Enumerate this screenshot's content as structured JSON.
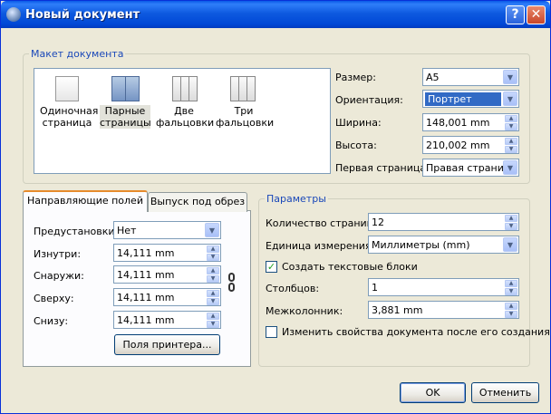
{
  "window": {
    "title": "Новый документ",
    "help": "?",
    "close": "✕"
  },
  "layout_group": {
    "title": "Макет документа",
    "layouts": [
      {
        "line1": "Одиночная",
        "line2": "страница"
      },
      {
        "line1": "Парные",
        "line2": "страницы"
      },
      {
        "line1": "Две",
        "line2": "фальцовки"
      },
      {
        "line1": "Три",
        "line2": "фальцовки"
      }
    ],
    "selected": "Парные страницы"
  },
  "size": {
    "label": "Размер:",
    "value": "A5"
  },
  "orientation": {
    "label": "Ориентация:",
    "value": "Портрет"
  },
  "width": {
    "label": "Ширина:",
    "value": "148,001 mm"
  },
  "height": {
    "label": "Высота:",
    "value": "210,002 mm"
  },
  "first_page": {
    "label": "Первая страница:",
    "value": "Правая страница"
  },
  "tabs": {
    "margins": "Направляющие полей",
    "bleed": "Выпуск под обрез",
    "active": "Направляющие полей"
  },
  "margins": {
    "presets": {
      "label": "Предустановки:",
      "value": "Нет"
    },
    "inside": {
      "label": "Изнутри:",
      "value": "14,111 mm"
    },
    "outside": {
      "label": "Снаружи:",
      "value": "14,111 mm"
    },
    "top": {
      "label": "Сверху:",
      "value": "14,111 mm"
    },
    "bottom": {
      "label": "Снизу:",
      "value": "14,111 mm"
    },
    "printer_button": "Поля принтера..."
  },
  "options": {
    "title": "Параметры",
    "page_count": {
      "label": "Количество страниц:",
      "value": "12"
    },
    "units": {
      "label": "Единица измерения:",
      "value": "Миллиметры (mm)"
    },
    "create_text_frames": {
      "label": "Создать текстовые блоки",
      "checked": true
    },
    "columns": {
      "label": "Столбцов:",
      "value": "1"
    },
    "gap": {
      "label": "Межколонник:",
      "value": "3,881 mm"
    },
    "change_settings": {
      "label": "Изменить свойства документа после его создания",
      "checked": false
    }
  },
  "buttons": {
    "ok": "OK",
    "cancel": "Отменить"
  },
  "icons": {
    "arrow": "▼",
    "up": "▲",
    "down": "▼",
    "check": "✓"
  },
  "colors": {
    "title_bar": "#0148d6",
    "selection": "#316ac5",
    "group_title": "#1a48b9"
  }
}
